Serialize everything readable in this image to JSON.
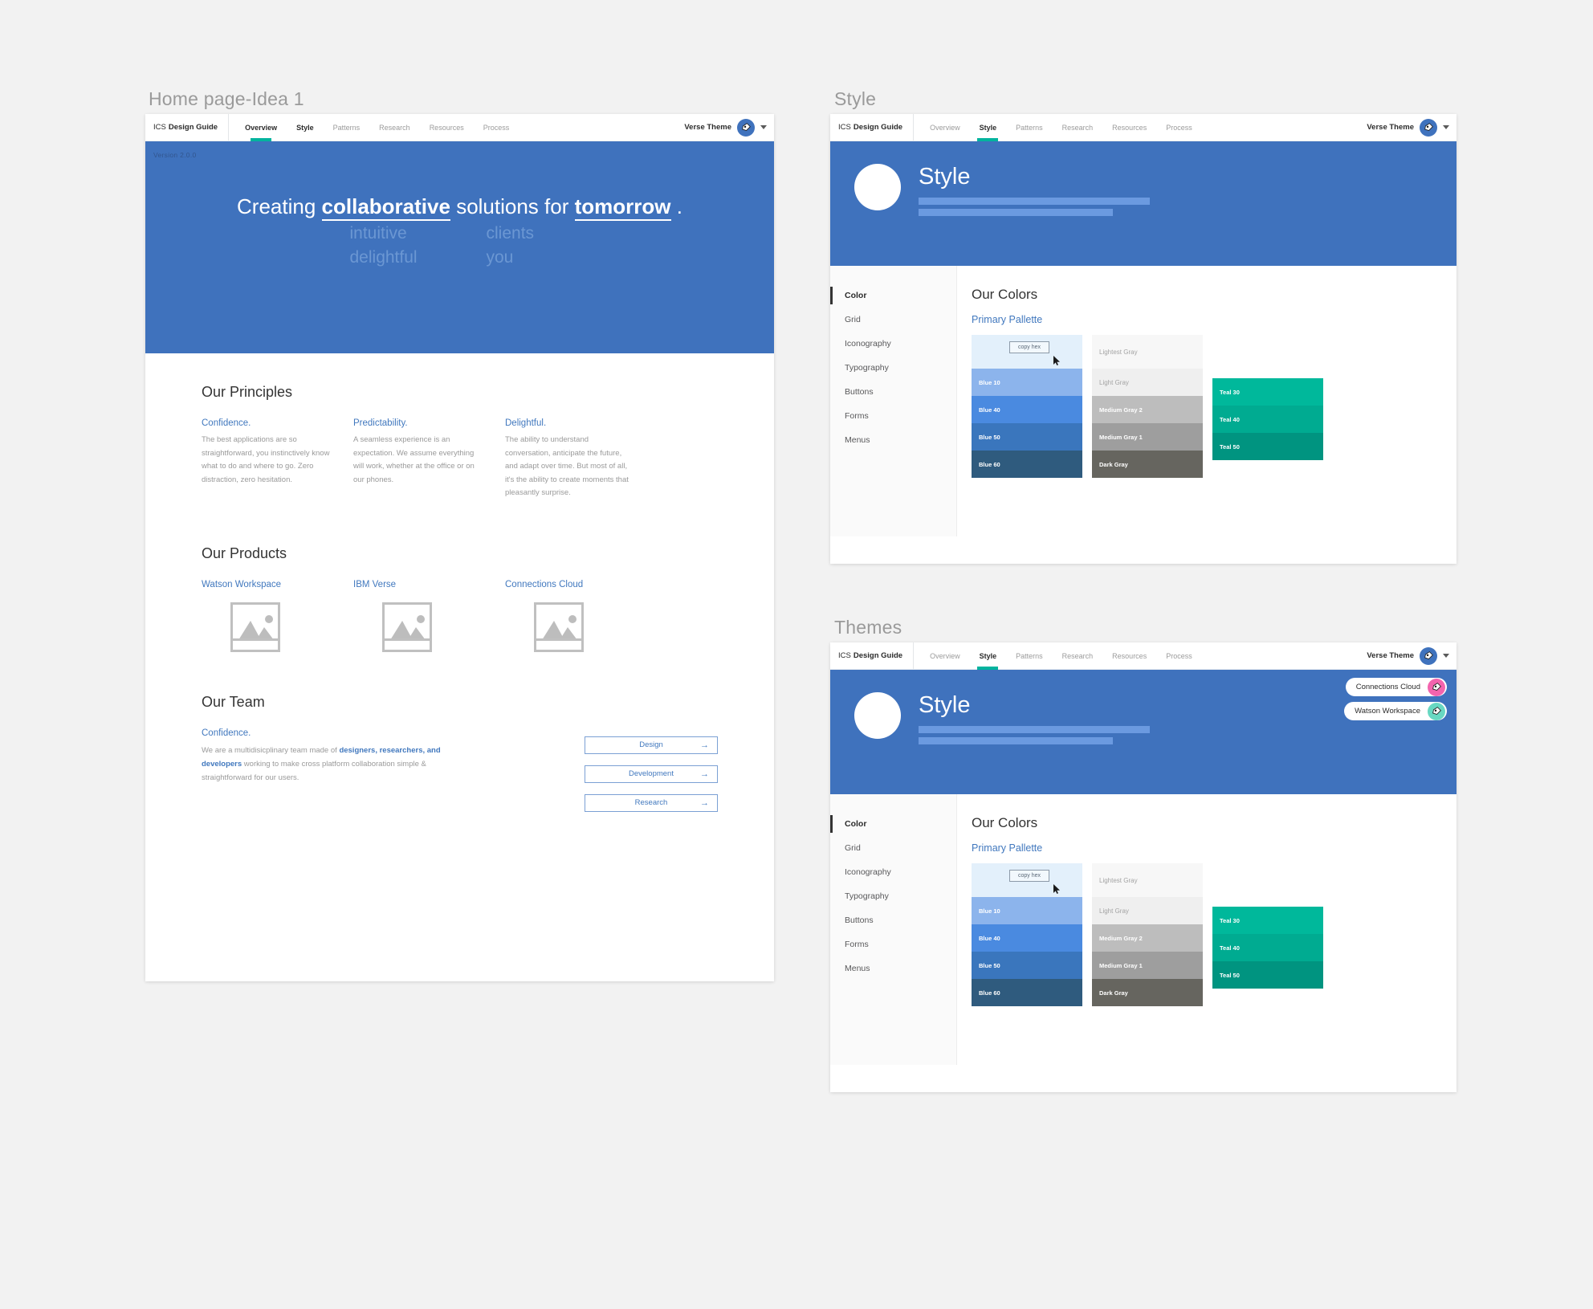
{
  "panels": {
    "home_caption": "Home page-Idea 1",
    "style_caption": "Style",
    "themes_caption": "Themes"
  },
  "nav": {
    "brand_prefix": "ICS",
    "brand_name": "Design Guide",
    "links": [
      {
        "label": "Overview",
        "active_home": true,
        "active_style": false
      },
      {
        "label": "Style",
        "active_home": false,
        "active_style": true
      },
      {
        "label": "Patterns",
        "active_home": false,
        "active_style": false
      },
      {
        "label": "Research",
        "active_home": false,
        "active_style": false
      },
      {
        "label": "Resources",
        "active_home": false,
        "active_style": false
      },
      {
        "label": "Process",
        "active_home": false,
        "active_style": false
      }
    ],
    "theme_label": "Verse Theme",
    "theme_icon": "paint-palette-icon",
    "caret_icon": "chevron-down-icon"
  },
  "home": {
    "version": "Version 2.0.0",
    "hero": {
      "line1_a": "Creating",
      "line1_b": "collaborative",
      "line1_c": "solutions for",
      "line1_d": "tomorrow",
      "line1_e": ".",
      "row2_left": "intuitive",
      "row2_right": "clients",
      "row3_left": "delightful",
      "row3_right": "you"
    },
    "principles": {
      "title": "Our Principles",
      "items": [
        {
          "head": "Confidence.",
          "body": "The best applications are so straightforward, you instinctively know what to do and where to go. Zero distraction, zero hesitation."
        },
        {
          "head": "Predictability.",
          "body": "A seamless experience is an expectation. We assume everything will work, whether at the office or on our phones."
        },
        {
          "head": "Delightful.",
          "body": "The ability to understand conversation, anticipate the future, and adapt over time. But most of all, it's the ability to create moments that pleasantly surprise."
        }
      ]
    },
    "products": {
      "title": "Our Products",
      "items": [
        {
          "name": "Watson Workspace",
          "icon": "image-placeholder-icon"
        },
        {
          "name": "IBM Verse",
          "icon": "image-placeholder-icon"
        },
        {
          "name": "Connections Cloud",
          "icon": "image-placeholder-icon"
        }
      ]
    },
    "team": {
      "title": "Our Team",
      "head": "Confidence.",
      "body_1": "We are a multidisicplinary team made of ",
      "body_link": "designers, researchers, and developers",
      "body_2": " working to make cross platform collaboration simple & straightforward for our users.",
      "buttons": [
        {
          "label": "Design",
          "icon": "arrow-right-icon"
        },
        {
          "label": "Development",
          "icon": "arrow-right-icon"
        },
        {
          "label": "Research",
          "icon": "arrow-right-icon"
        }
      ]
    }
  },
  "style_app": {
    "hero_title": "Style",
    "sidebar": [
      {
        "label": "Color",
        "active": true
      },
      {
        "label": "Grid",
        "active": false
      },
      {
        "label": "Iconography",
        "active": false
      },
      {
        "label": "Typography",
        "active": false
      },
      {
        "label": "Buttons",
        "active": false
      },
      {
        "label": "Forms",
        "active": false
      },
      {
        "label": "Menus",
        "active": false
      }
    ],
    "pane_title": "Our Colors",
    "pane_sub": "Primary Pallette",
    "copy_hex_tooltip": "copy hex",
    "cursor_icon": "mouse-pointer-icon",
    "swatches": {
      "blue": [
        {
          "label": "",
          "hex": "#e3f0fb",
          "light": true
        },
        {
          "label": "Blue 10",
          "hex": "#8cb4ec",
          "light": false
        },
        {
          "label": "Blue 40",
          "hex": "#4a8ae0",
          "light": false
        },
        {
          "label": "Blue 50",
          "hex": "#3a76bd",
          "light": false
        },
        {
          "label": "Blue 60",
          "hex": "#2f5b7e",
          "light": false
        }
      ],
      "gray": [
        {
          "label": "Lightest Gray",
          "hex": "#f7f7f7",
          "light": true
        },
        {
          "label": "Light Gray",
          "hex": "#efefef",
          "light": true
        },
        {
          "label": "Medium Gray 2",
          "hex": "#bdbdbd",
          "light": false
        },
        {
          "label": "Medium Gray 1",
          "hex": "#9e9e9e",
          "light": false
        },
        {
          "label": "Dark Gray",
          "hex": "#66655f",
          "light": false
        }
      ],
      "teal": [
        {
          "label": "Teal 30",
          "hex": "#00b89b",
          "light": false
        },
        {
          "label": "Teal 40",
          "hex": "#00ab91",
          "light": false
        },
        {
          "label": "Teal 50",
          "hex": "#009480",
          "light": false
        }
      ]
    }
  },
  "themes_app": {
    "hero_title": "Style",
    "theme_menu": [
      {
        "label": "Connections Cloud",
        "dot": "pink",
        "icon": "paint-palette-icon"
      },
      {
        "label": "Watson Workspace",
        "dot": "teal",
        "icon": "paint-palette-icon"
      }
    ]
  },
  "colors": {
    "brand_blue": "#3f72bd",
    "accent_teal": "#00b39e",
    "link_blue": "#4178be",
    "page_bg": "#f2f2f2"
  }
}
